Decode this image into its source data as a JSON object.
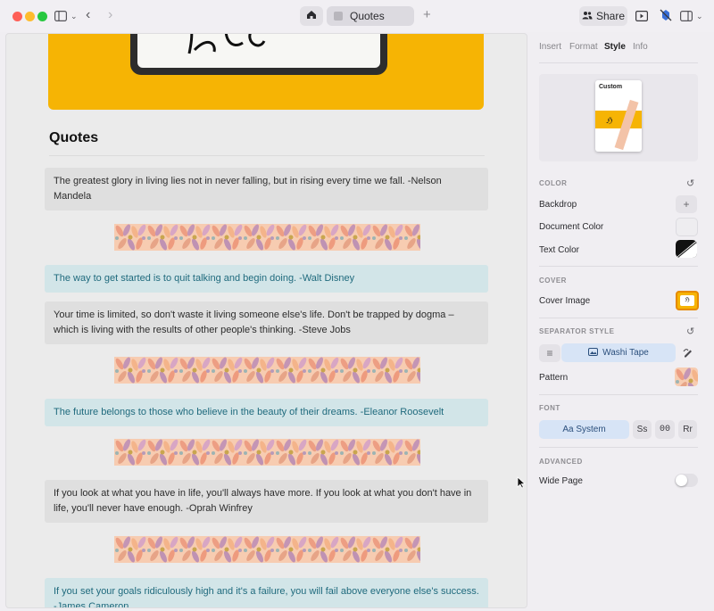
{
  "window": {
    "tab_title": "Quotes",
    "share_label": "Share"
  },
  "document": {
    "heading": "Quotes",
    "quotes": [
      {
        "text": "The greatest glory in living lies not in never falling, but in rising every time we fall. -Nelson Mandela"
      },
      {
        "text": "The way to get started is to quit talking and begin doing. -Walt Disney"
      },
      {
        "text": "Your time is limited, so don't waste it living someone else's life. Don't be trapped by dogma – which is living with the results of other people's thinking. -Steve Jobs"
      },
      {
        "text": "The future belongs to those who believe in the beauty of their dreams. -Eleanor Roosevelt"
      },
      {
        "text": "If you look at what you have in life, you'll always have more. If you look at what you don't have in life, you'll never have enough. -Oprah Winfrey"
      },
      {
        "text": "If you set your goals ridiculously high and it's a failure, you will fail above everyone else's success. -James Cameron"
      }
    ]
  },
  "inspector": {
    "tabs": [
      "Insert",
      "Format",
      "Style",
      "Info"
    ],
    "active_tab": "Style",
    "preview_label": "Custom",
    "color_section": "COLOR",
    "backdrop_label": "Backdrop",
    "document_color_label": "Document Color",
    "text_color_label": "Text Color",
    "cover_section": "COVER",
    "cover_image_label": "Cover Image",
    "separator_section": "SEPARATOR STYLE",
    "separator_value": "Washi Tape",
    "pattern_label": "Pattern",
    "font_section": "FONT",
    "font_system": "Aa System",
    "font_serif": "Ss",
    "font_mono": "00",
    "font_round": "Rr",
    "advanced_section": "ADVANCED",
    "wide_page_label": "Wide Page",
    "wide_page_on": false
  },
  "colors": {
    "accent": "#1f6a7d",
    "quote_blue_bg": "#d2e5e8",
    "cover_yellow": "#f6b404",
    "washi_base": "#f7ccb1"
  },
  "icons": [
    "sidebar-toggle-icon",
    "chevron-down-icon",
    "back-icon",
    "forward-icon",
    "home-icon",
    "plus-icon",
    "share-icon",
    "play-icon",
    "focus-icon",
    "inspector-toggle-icon",
    "reset-icon",
    "add-icon",
    "list-icon",
    "pen-icon",
    "cursor-icon"
  ]
}
